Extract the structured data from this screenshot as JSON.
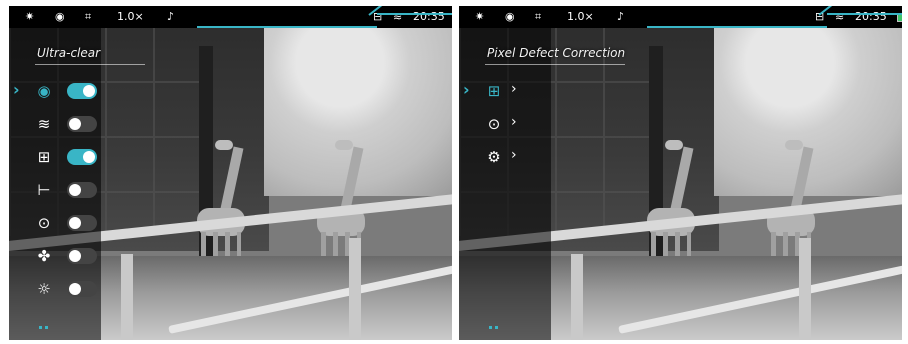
{
  "screens": [
    {
      "status": {
        "zoom": "1.0×",
        "time": "20:35"
      },
      "menu": {
        "title": "Ultra-clear",
        "items": [
          {
            "icon": "eye-icon",
            "glyph": "◉",
            "active": true,
            "toggle": true
          },
          {
            "icon": "wifi-icon",
            "glyph": "≋",
            "active": false,
            "toggle": false
          },
          {
            "icon": "pip-icon",
            "glyph": "⊞",
            "active": false,
            "toggle": true
          },
          {
            "icon": "rangefinder-icon",
            "glyph": "⊢",
            "active": false,
            "toggle": false
          },
          {
            "icon": "compass-icon",
            "glyph": "⊙",
            "active": false,
            "toggle": false
          },
          {
            "icon": "fan-icon",
            "glyph": "✤",
            "active": false,
            "toggle": false
          },
          {
            "icon": "brightness-icon",
            "glyph": "☼",
            "active": false,
            "toggle": false
          }
        ]
      }
    },
    {
      "status": {
        "zoom": "1.0×",
        "time": "20:35"
      },
      "menu": {
        "title": "Pixel Defect Correction",
        "items": [
          {
            "icon": "pixel-correction-icon",
            "glyph": "⊞",
            "active": true,
            "arrow": "›"
          },
          {
            "icon": "compass-icon",
            "glyph": "⊙",
            "active": false,
            "arrow": "›"
          },
          {
            "icon": "settings-gear-icon",
            "glyph": "⚙",
            "active": false,
            "arrow": "›"
          }
        ]
      }
    }
  ],
  "colors": {
    "accent": "#39b5c6",
    "battery": "#3ec46a"
  }
}
